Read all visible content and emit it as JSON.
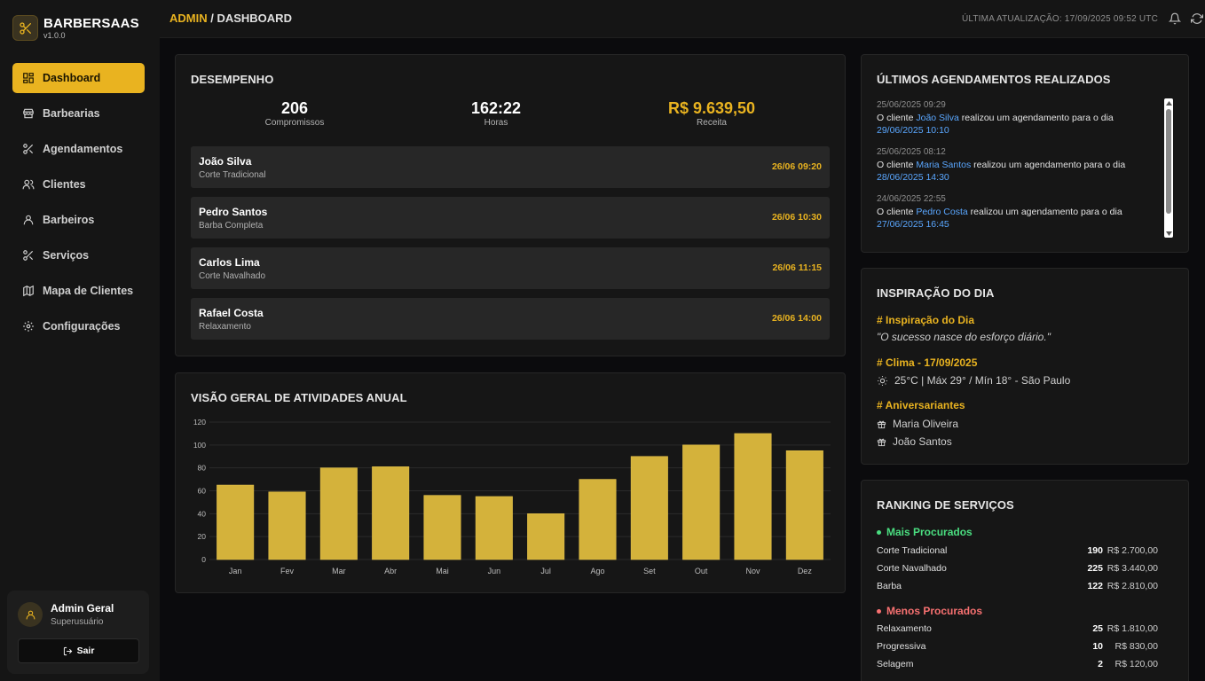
{
  "brand": {
    "name": "BARBERSAAS",
    "version": "v1.0.0"
  },
  "nav": [
    {
      "label": "Dashboard",
      "icon": "dashboard-icon",
      "active": true
    },
    {
      "label": "Barbearias",
      "icon": "store-icon"
    },
    {
      "label": "Agendamentos",
      "icon": "scissors-icon"
    },
    {
      "label": "Clientes",
      "icon": "users-icon"
    },
    {
      "label": "Barbeiros",
      "icon": "user-icon"
    },
    {
      "label": "Serviços",
      "icon": "scissors-icon"
    },
    {
      "label": "Mapa de Clientes",
      "icon": "map-icon"
    },
    {
      "label": "Configurações",
      "icon": "gear-icon"
    }
  ],
  "user": {
    "name": "Admin Geral",
    "role": "Superusuário",
    "logout_label": "Sair"
  },
  "topbar": {
    "crumb_root": "ADMIN",
    "crumb_sep": " / ",
    "crumb_page": "DASHBOARD",
    "last_update": "ÚLTIMA ATUALIZAÇÃO: 17/09/2025 09:52 UTC"
  },
  "performance": {
    "title": "DESEMPENHO",
    "stats": [
      {
        "value": "206",
        "label": "Compromissos"
      },
      {
        "value": "162:22",
        "label": "Horas"
      },
      {
        "value": "R$ 9.639,50",
        "label": "Receita"
      }
    ],
    "appointments": [
      {
        "name": "João Silva",
        "service": "Corte Tradicional",
        "time": "26/06 09:20"
      },
      {
        "name": "Pedro Santos",
        "service": "Barba Completa",
        "time": "26/06 10:30"
      },
      {
        "name": "Carlos Lima",
        "service": "Corte Navalhado",
        "time": "26/06 11:15"
      },
      {
        "name": "Rafael Costa",
        "service": "Relaxamento",
        "time": "26/06 14:00"
      }
    ]
  },
  "activity": {
    "title": "VISÃO GERAL DE ATIVIDADES ANUAL"
  },
  "chart_data": {
    "type": "bar",
    "categories": [
      "Jan",
      "Fev",
      "Mar",
      "Abr",
      "Mai",
      "Jun",
      "Jul",
      "Ago",
      "Set",
      "Out",
      "Nov",
      "Dez"
    ],
    "values": [
      65,
      59,
      80,
      81,
      56,
      55,
      40,
      70,
      90,
      100,
      110,
      95
    ],
    "title": "VISÃO GERAL DE ATIVIDADES ANUAL",
    "xlabel": "",
    "ylabel": "",
    "ylim": [
      0,
      120
    ],
    "yticks": [
      0,
      20,
      40,
      60,
      80,
      100,
      120
    ],
    "grid": true,
    "bar_color": "#d4b23b"
  },
  "latest": {
    "title": "ÚLTIMOS AGENDAMENTOS REALIZADOS",
    "items": [
      {
        "date": "25/06/2025 09:29",
        "prefix": "O cliente ",
        "client": "João Silva",
        "middle": " realizou um agendamento para o dia",
        "target": "29/06/2025 10:10"
      },
      {
        "date": "25/06/2025 08:12",
        "prefix": "O cliente ",
        "client": "Maria Santos",
        "middle": " realizou um agendamento para o dia",
        "target": "28/06/2025 14:30"
      },
      {
        "date": "24/06/2025 22:55",
        "prefix": "O cliente ",
        "client": "Pedro Costa",
        "middle": " realizou um agendamento para o dia",
        "target": "27/06/2025 16:45"
      }
    ]
  },
  "inspiration": {
    "title": "INSPIRAÇÃO DO DIA",
    "quote_head": "# Inspiração do Dia",
    "quote": "\"O sucesso nasce do esforço diário.\"",
    "weather_head": "# Clima - 17/09/2025",
    "weather": "25°C | Máx 29° / Mín 18° - São Paulo",
    "birthday_head": "# Aniversariantes",
    "birthdays": [
      "Maria Oliveira",
      "João Santos"
    ]
  },
  "ranking": {
    "title": "RANKING DE SERVIÇOS",
    "top_label": "Mais Procurados",
    "top_color": "#4ade80",
    "top": [
      {
        "name": "Corte Tradicional",
        "count": "190",
        "value": "R$ 2.700,00"
      },
      {
        "name": "Corte Navalhado",
        "count": "225",
        "value": "R$ 3.440,00"
      },
      {
        "name": "Barba",
        "count": "122",
        "value": "R$ 2.810,00"
      }
    ],
    "bottom_label": "Menos Procurados",
    "bottom_color": "#f87171",
    "bottom": [
      {
        "name": "Relaxamento",
        "count": "25",
        "value": "R$ 1.810,00"
      },
      {
        "name": "Progressiva",
        "count": "10",
        "value": "R$ 830,00"
      },
      {
        "name": "Selagem",
        "count": "2",
        "value": "R$ 120,00"
      }
    ]
  }
}
